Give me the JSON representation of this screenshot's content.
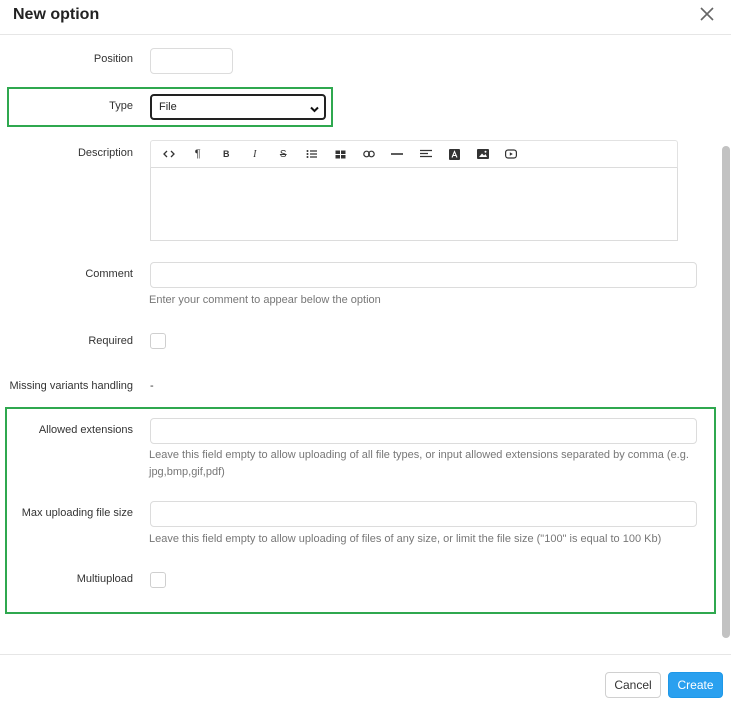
{
  "dialog": {
    "title": "New option",
    "close_icon": "close-icon"
  },
  "form": {
    "position": {
      "label": "Position",
      "value": ""
    },
    "type": {
      "label": "Type",
      "value": "File",
      "arrow_icon": "chevron-down-icon"
    },
    "description": {
      "label": "Description",
      "value": "",
      "toolbar": [
        {
          "name": "code-view-icon",
          "glyph": "<>"
        },
        {
          "name": "paragraph-icon",
          "glyph": "¶"
        },
        {
          "name": "bold-icon",
          "glyph": "B"
        },
        {
          "name": "italic-icon",
          "glyph": "I"
        },
        {
          "name": "strikethrough-icon",
          "glyph": "S"
        },
        {
          "name": "unordered-list-icon",
          "glyph": ""
        },
        {
          "name": "table-icon",
          "glyph": ""
        },
        {
          "name": "link-icon",
          "glyph": ""
        },
        {
          "name": "horizontal-rule-icon",
          "glyph": ""
        },
        {
          "name": "align-icon",
          "glyph": ""
        },
        {
          "name": "font-color-icon",
          "glyph": "A"
        },
        {
          "name": "image-icon",
          "glyph": ""
        },
        {
          "name": "video-icon",
          "glyph": ""
        }
      ]
    },
    "comment": {
      "label": "Comment",
      "value": "",
      "hint": "Enter your comment to appear below the option"
    },
    "required": {
      "label": "Required",
      "checked": false
    },
    "missing_variants": {
      "label": "Missing variants handling",
      "value": "-"
    },
    "allowed_extensions": {
      "label": "Allowed extensions",
      "value": "",
      "hint_line1": "Leave this field empty to allow uploading of all file types, or input allowed extensions separated by comma (e.g.",
      "hint_line2": "jpg,bmp,gif,pdf)"
    },
    "max_size": {
      "label": "Max uploading file size",
      "value": "",
      "hint": "Leave this field empty to allow uploading of files of any size, or limit the file size (\"100\" is equal to 100 Kb)"
    },
    "multiupload": {
      "label": "Multiupload",
      "checked": false
    }
  },
  "footer": {
    "cancel_label": "Cancel",
    "create_label": "Create"
  },
  "colors": {
    "highlight": "#2fa84f",
    "primary": "#2aa0ef"
  }
}
